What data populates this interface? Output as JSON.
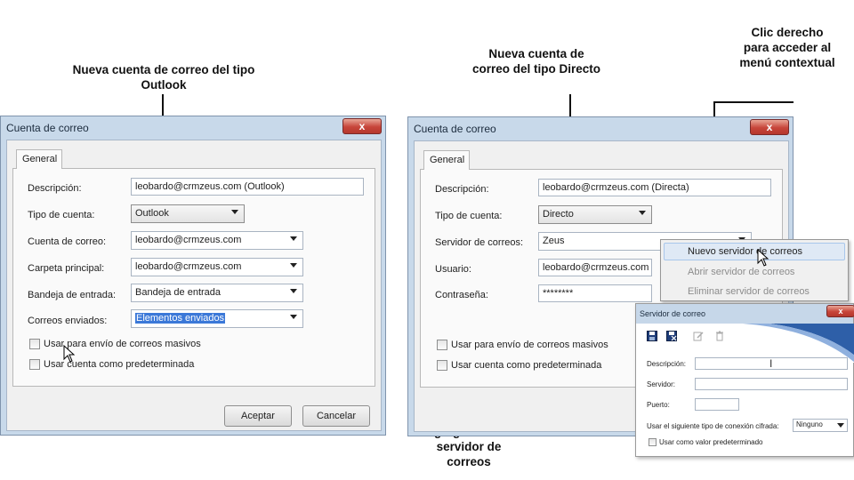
{
  "annotations": {
    "left_title": "Nueva cuenta de correo del tipo Outlook",
    "middle_title": "Nueva cuenta de correo del tipo Directo",
    "right_title": "Clic derecho para acceder al menú contextual",
    "bottom_title": "Ventana para agregar nuevo servidor de correos"
  },
  "dialog_outlook": {
    "title": "Cuenta de correo",
    "close_label": "x",
    "tab": "General",
    "labels": {
      "descripcion": "Descripción:",
      "tipo_cuenta": "Tipo de cuenta:",
      "cuenta_correo": "Cuenta de correo:",
      "carpeta_principal": "Carpeta principal:",
      "bandeja_entrada": "Bandeja de entrada:",
      "correos_enviados": "Correos enviados:"
    },
    "values": {
      "descripcion": "leobardo@crmzeus.com (Outlook)",
      "tipo_cuenta": "Outlook",
      "cuenta_correo": "leobardo@crmzeus.com",
      "carpeta_principal": "leobardo@crmzeus.com",
      "bandeja_entrada": "Bandeja de entrada",
      "correos_enviados": "Elementos enviados"
    },
    "checkboxes": {
      "envio_masivo": "Usar para envío de correos masivos",
      "predeterminada": "Usar cuenta como predeterminada"
    },
    "buttons": {
      "aceptar": "Aceptar",
      "cancelar": "Cancelar"
    }
  },
  "dialog_directo": {
    "title": "Cuenta de correo",
    "close_label": "x",
    "tab": "General",
    "labels": {
      "descripcion": "Descripción:",
      "tipo_cuenta": "Tipo de cuenta:",
      "servidor": "Servidor de correos:",
      "usuario": "Usuario:",
      "contrasena": "Contraseña:"
    },
    "values": {
      "descripcion": "leobardo@crmzeus.com (Directa)",
      "tipo_cuenta": "Directo",
      "servidor": "Zeus",
      "usuario": "leobardo@crmzeus.com",
      "contrasena": "********"
    },
    "checkboxes": {
      "envio_masivo": "Usar para envío de correos masivos",
      "predeterminada": "Usar cuenta como predeterminada"
    }
  },
  "context_menu": {
    "items": [
      "Nuevo servidor de correos",
      "Abrir servidor de correos",
      "Eliminar servidor de correos"
    ]
  },
  "server_dialog": {
    "title": "Servidor de correo",
    "close_label": "x",
    "labels": {
      "descripcion": "Descripción:",
      "servidor": "Servidor:",
      "puerto": "Puerto:",
      "conexion": "Usar el siguiente tipo de conexión cifrada:",
      "predeterminado": "Usar como valor predeterminado"
    },
    "values": {
      "conexion": "Ninguno"
    }
  }
}
